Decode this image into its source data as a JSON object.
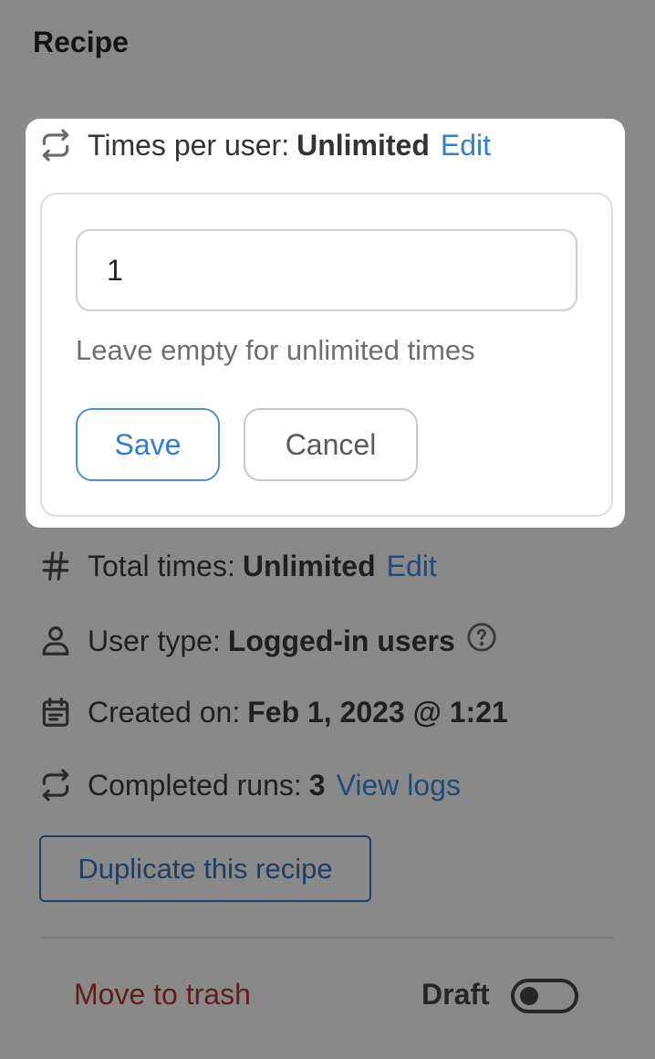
{
  "panel": {
    "title": "Recipe"
  },
  "times_per_user": {
    "label": "Times per user:",
    "value": "Unlimited",
    "edit_link": "Edit",
    "input_value": "1",
    "hint": "Leave empty for unlimited times",
    "save_label": "Save",
    "cancel_label": "Cancel"
  },
  "total_times": {
    "label": "Total times:",
    "value": "Unlimited",
    "edit_link": "Edit"
  },
  "user_type": {
    "label": "User type:",
    "value": "Logged-in users"
  },
  "created_on": {
    "label": "Created on:",
    "value": "Feb 1, 2023 @ 1:21"
  },
  "completed_runs": {
    "label": "Completed runs:",
    "value": "3",
    "link": "View logs"
  },
  "duplicate_button": "Duplicate this recipe",
  "footer": {
    "trash_link": "Move to trash",
    "status_label": "Draft"
  },
  "colors": {
    "link_active": "#2f7fd8",
    "link_dimmed": "#214a78",
    "danger": "#621c1c"
  },
  "icons": {
    "times_per_user": "repeat-icon",
    "total_times": "hash-icon",
    "user_type": "user-icon",
    "help": "question-circle-icon",
    "created_on": "calendar-icon",
    "completed_runs": "repeat-icon"
  }
}
